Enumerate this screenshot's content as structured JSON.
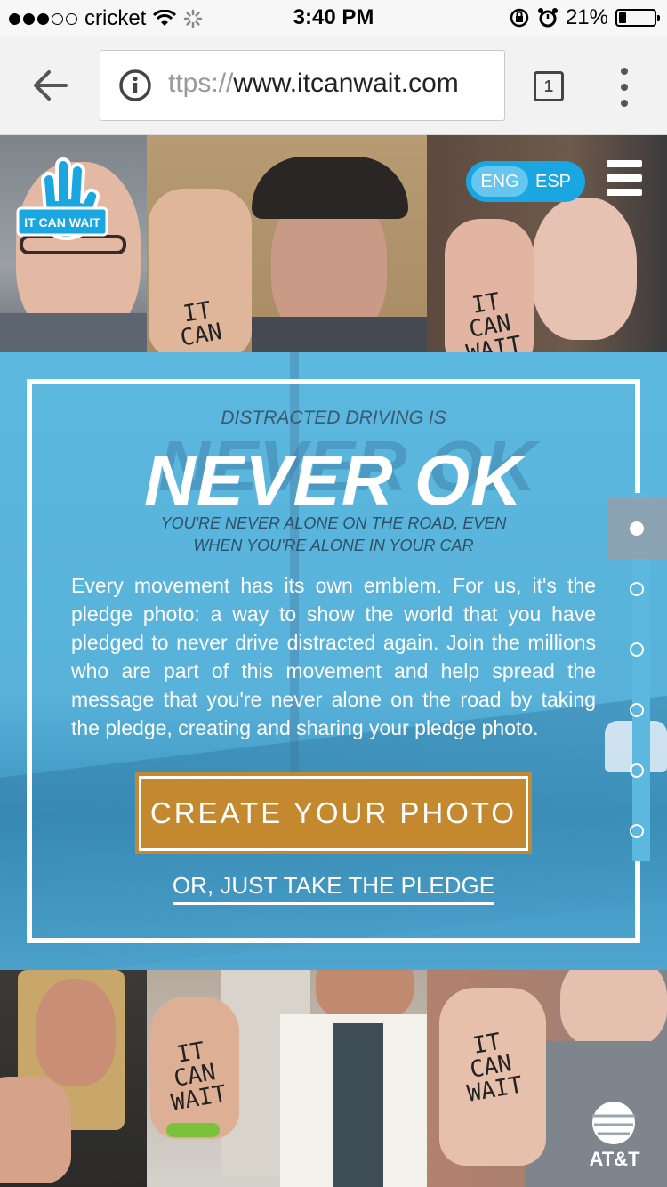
{
  "status_bar": {
    "carrier": "cricket",
    "time": "3:40 PM",
    "battery": "21%",
    "battery_level": 0.21
  },
  "browser": {
    "url_protocol": "ttps://",
    "url_host": "www.itcanwait.com",
    "tab_count": "1"
  },
  "header": {
    "logo_text": "IT CAN WAIT",
    "lang_eng": "ENG",
    "lang_esp": "ESP"
  },
  "photos": {
    "top_hand_2": "IT\nCAN",
    "top_hand_3": "IT\nCAN\nWAIT",
    "bottom_hand_2": "IT\nCAN\nWAIT",
    "bottom_hand_3": "IT\nCAN\nWAIT"
  },
  "hero": {
    "kicker": "DISTRACTED DRIVING IS",
    "headline": "NEVER OK",
    "subhead_line1": "YOU'RE NEVER ALONE ON THE ROAD, EVEN",
    "subhead_line2": "WHEN YOU'RE ALONE IN YOUR CAR",
    "body": "Every movement has its own emblem. For us, it's the pledge photo: a way to show the world that you have pledged to never drive distracted again. Join the millions who are part of this movement and help spread the message that you're never alone on the road by taking the pledge, creating and sharing your pledge photo.",
    "cta_label": "CREATE YOUR PHOTO",
    "pledge_link": "OR, JUST TAKE THE PLEDGE"
  },
  "pager": {
    "count": 6,
    "active_index": 0
  },
  "footer": {
    "brand": "AT&T"
  },
  "colors": {
    "hero_blue": "#5cb8df",
    "cta_gold": "#c4892f",
    "toggle_blue": "#1aa6e0",
    "logo_blue": "#1aa6e0"
  }
}
